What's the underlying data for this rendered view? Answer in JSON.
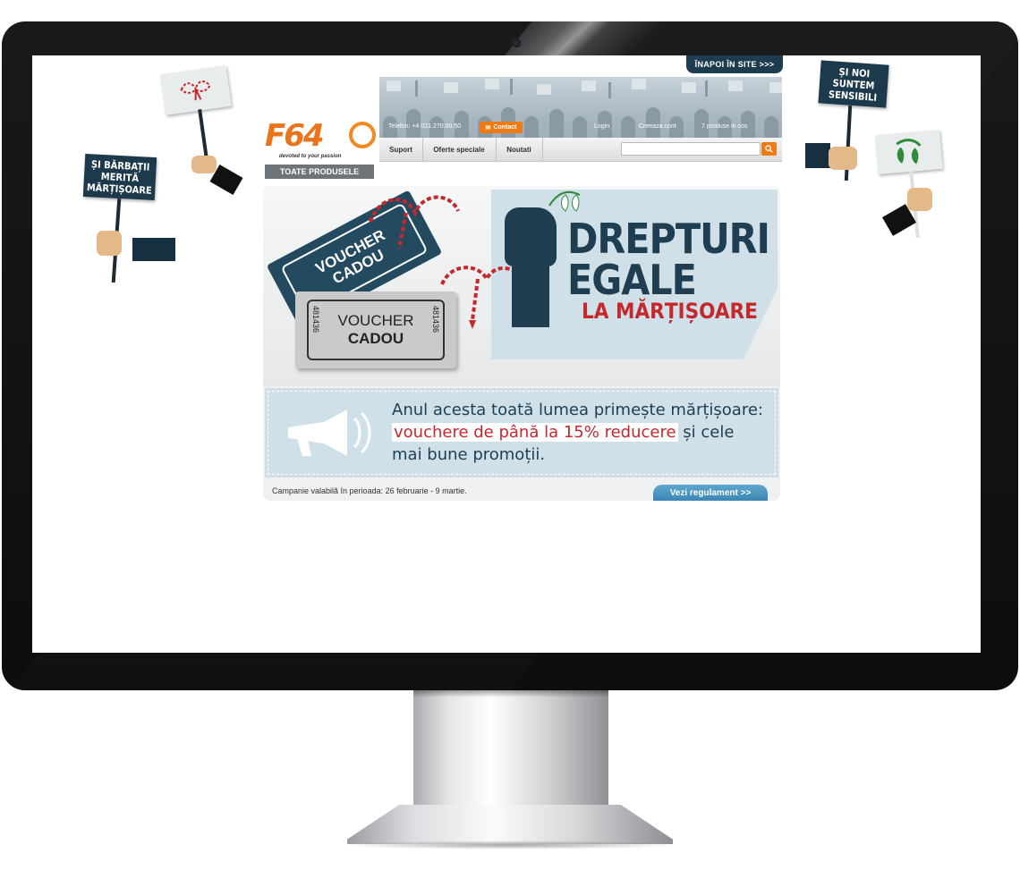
{
  "site": {
    "back_link": "ÎNAPOI ÎN SITE  >>>",
    "logo_text": "F64",
    "logo_tagline": "devoted to your passion",
    "all_products": "TOATE PRODUSELE",
    "phone": "Telefon: +4 021.270.00.50",
    "contact": "Contact",
    "login": "Login",
    "create_account": "Creeaza cont",
    "cart": "7 produse in cos",
    "nav": [
      "Suport",
      "Oferte speciale",
      "Noutati"
    ],
    "search_placeholder": ""
  },
  "banner": {
    "voucher_top": "VOUCHER\nCADOU",
    "voucher_front_1": "VOUCHER",
    "voucher_front_2": "CADOU",
    "serial": "481436",
    "headline_1": "DREPTURI",
    "headline_2": "EGALE",
    "subheadline": "LA MĂRȚIȘOARE",
    "promo_line_1": "Anul acesta toată lumea primește mărțișoare:",
    "promo_highlight": "vouchere de până la 15% reducere",
    "promo_line_2": " și cele",
    "promo_line_3": "mai bune promoții.",
    "campaign": "Campanie valabilă în perioada: 26 februarie - 9 martie.",
    "rules_button": "Vezi regulament  >>"
  },
  "signs": {
    "left_big": "ȘI BĂRBAȚII MERITĂ MĂRȚIȘOARE",
    "right_top": "ȘI NOI SUNTEM SENSIBILI"
  },
  "colors": {
    "navy": "#1f3e52",
    "orange": "#ee7a14",
    "red": "#c4282d",
    "light_blue": "#cfe0e8"
  }
}
